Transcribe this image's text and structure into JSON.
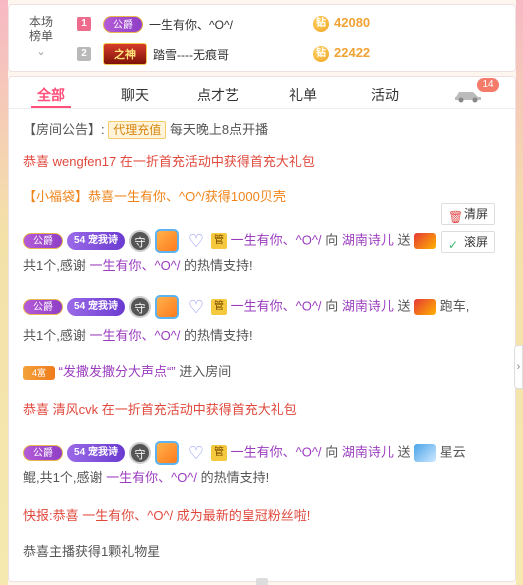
{
  "rank": {
    "label_line1": "本场",
    "label_line2": "榜单",
    "chevron": "⌄",
    "rows": [
      {
        "num": "1",
        "badge": "公爵",
        "name": "一生有你、^O^/",
        "coin": "钻",
        "score": "42080"
      },
      {
        "num": "2",
        "badge": "之神",
        "name": "踏雪----无痕哥",
        "coin": "钻",
        "score": "22422"
      }
    ]
  },
  "tabs": [
    {
      "label": "全部"
    },
    {
      "label": "聊天"
    },
    {
      "label": "点才艺"
    },
    {
      "label": "礼单"
    },
    {
      "label": "活动"
    }
  ],
  "car_badge": "14",
  "side_buttons": {
    "clear": "清屏",
    "scroll": "滚屏"
  },
  "messages": {
    "announce_prefix": "【房间公告】:",
    "announce_tag": "代理充值",
    "announce_text": "每天晚上8点开播",
    "m1": "恭喜 wengfen17 在一折首充活动中获得首充大礼包",
    "m2": "【小福袋】恭喜一生有你、^O^/获得1000贝壳",
    "gong": "公爵",
    "pet": "54 宠我诗",
    "shou": "守",
    "guan": "管",
    "user": "一生有你、^O^/",
    "to": "向",
    "anchor": "湖南诗儿",
    "send": "送",
    "gift1_line2_a": "共1个,感谢",
    "thanks_suffix": "的热情支持!",
    "gift2_name": "跑车,",
    "gift2_line2_a": "共1个,感谢",
    "lvl": "4富",
    "enter_name": "“发撒发撒分大声点“”",
    "enter_text": "进入房间",
    "m6": "恭喜 清风cvk 在一折首充活动中获得首充大礼包",
    "gift3_name": "星云",
    "gift3_line2_a": "鲲,共1个,感谢",
    "m8": "快报:恭喜 一生有你、^O^/ 成为最新的皇冠粉丝啦!",
    "m9": "恭喜主播获得1颗礼物星"
  }
}
